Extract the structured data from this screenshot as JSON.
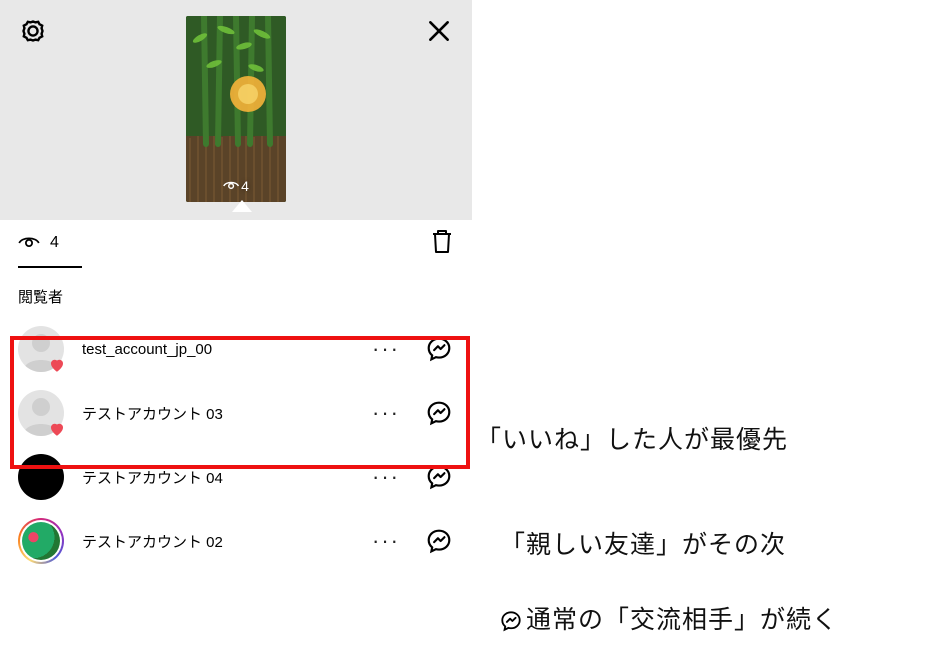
{
  "story": {
    "thumb_view_count": "4"
  },
  "toolbar": {
    "view_count": "4"
  },
  "section": {
    "title": "閲覧者"
  },
  "viewers": [
    {
      "username": "test_account_jp_00",
      "liked": true,
      "avatar_kind": "placeholder"
    },
    {
      "username": "テストアカウント 03",
      "liked": true,
      "avatar_kind": "placeholder"
    },
    {
      "username": "テストアカウント 04",
      "liked": false,
      "avatar_kind": "black"
    },
    {
      "username": "テストアカウント 02",
      "liked": false,
      "avatar_kind": "ring"
    }
  ],
  "annotations": {
    "liked_first": "「いいね」した人が最優先",
    "close_friends_next": "「親しい友達」がその次",
    "regular_follows": "通常の「交流相手」が続く"
  }
}
